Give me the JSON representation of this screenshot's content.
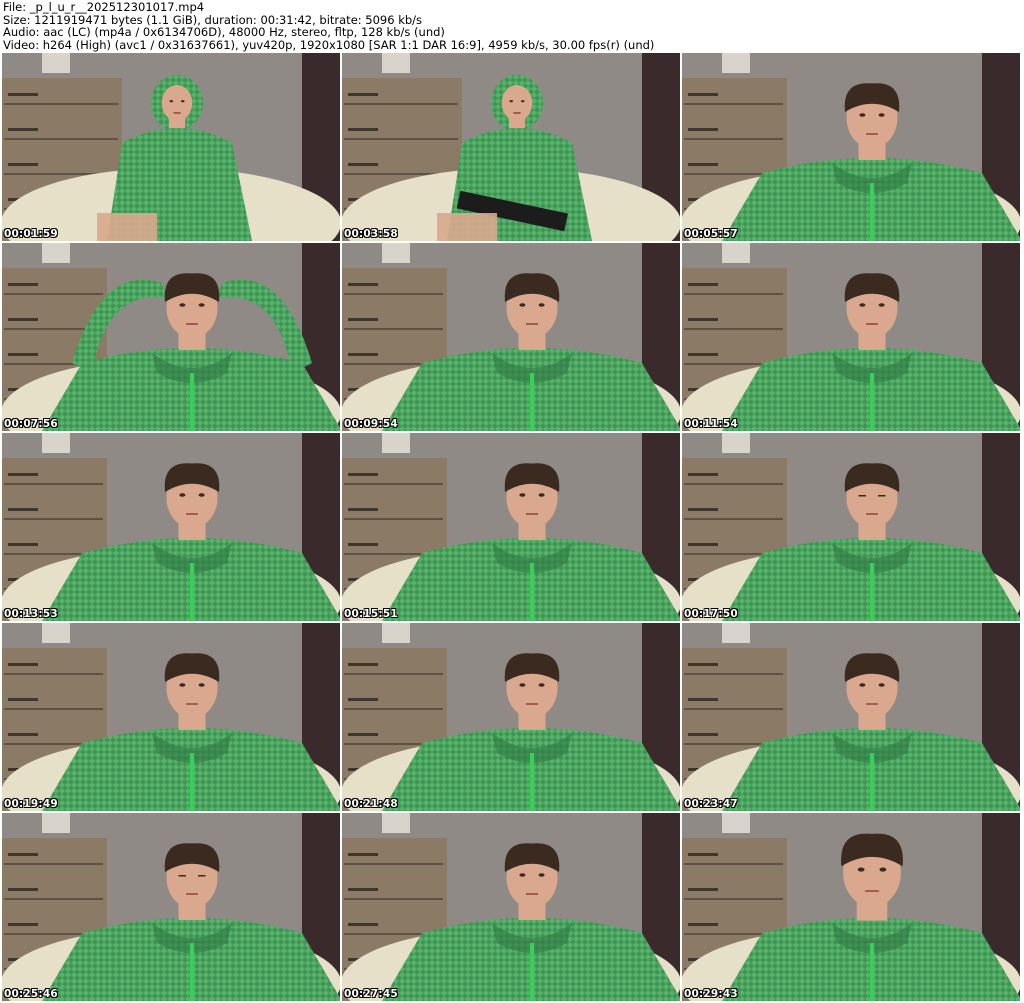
{
  "header": {
    "file_line": "File: _p_l_u_r__202512301017.mp4",
    "size_line": "Size: 1211919471 bytes (1.1 GiB), duration: 00:31:42, bitrate: 5096 kb/s",
    "audio_line": "Audio: aac (LC) (mp4a / 0x6134706D), 48000 Hz, stereo, fltp, 128 kb/s (und)",
    "video_line": "Video: h264 (High) (avc1 / 0x31637661), yuv420p, 1920x1080 [SAR 1:1 DAR 16:9], 4959 kb/s, 30.00 fps(r) (und)"
  },
  "thumbnails": [
    {
      "timestamp": "00:01:59",
      "scene": "wide-hood-up"
    },
    {
      "timestamp": "00:03:58",
      "scene": "wide-keyboard"
    },
    {
      "timestamp": "00:05:57",
      "scene": "close"
    },
    {
      "timestamp": "00:07:56",
      "scene": "hands-on-head"
    },
    {
      "timestamp": "00:09:54",
      "scene": "close"
    },
    {
      "timestamp": "00:11:54",
      "scene": "close"
    },
    {
      "timestamp": "00:13:53",
      "scene": "close"
    },
    {
      "timestamp": "00:15:51",
      "scene": "close"
    },
    {
      "timestamp": "00:17:50",
      "scene": "close-head-down"
    },
    {
      "timestamp": "00:19:49",
      "scene": "close-tilt"
    },
    {
      "timestamp": "00:21:48",
      "scene": "close"
    },
    {
      "timestamp": "00:23:47",
      "scene": "close"
    },
    {
      "timestamp": "00:25:46",
      "scene": "close-head-down"
    },
    {
      "timestamp": "00:27:45",
      "scene": "close"
    },
    {
      "timestamp": "00:29:43",
      "scene": "close-near"
    }
  ],
  "colors": {
    "wall": "#8f8a86",
    "dresser": "#8a7a66",
    "curtain": "#3b2a2c",
    "blanket": "#e6e0c8",
    "hoodie": "#56b36a",
    "hoodie_dark": "#2f7a45",
    "skin": "#d9a88e",
    "hair": "#3a2a20"
  }
}
